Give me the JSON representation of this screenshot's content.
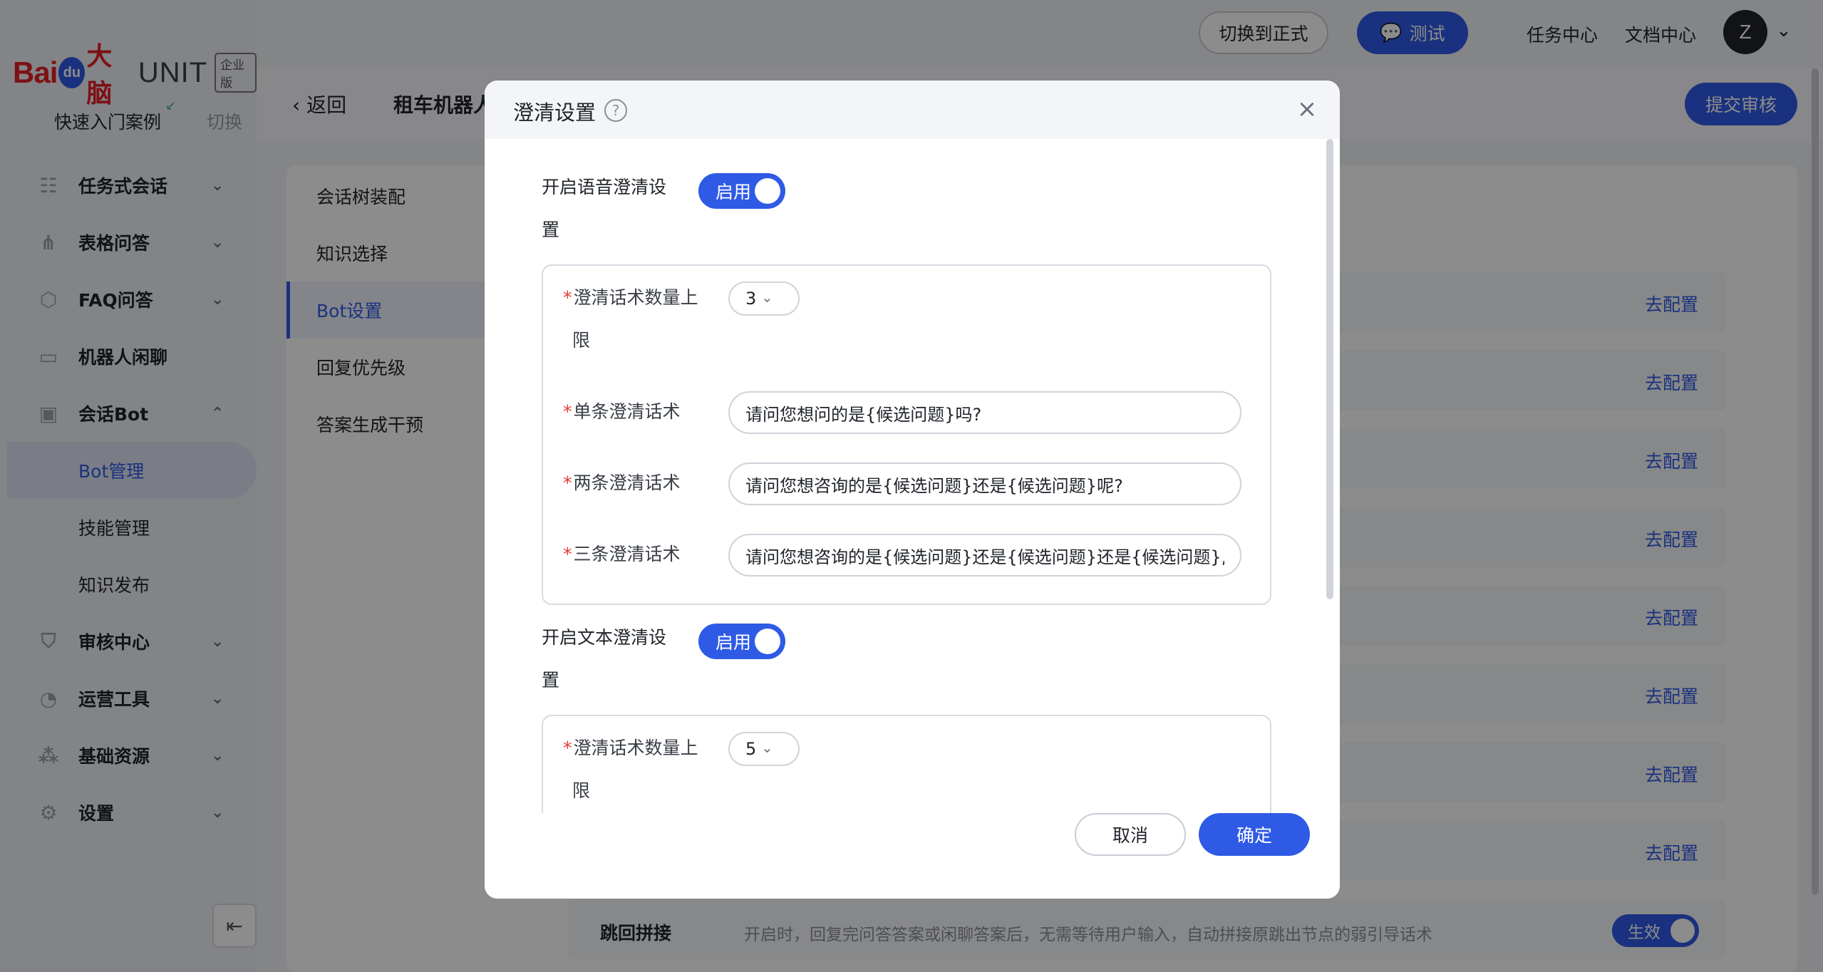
{
  "brand": {
    "bai": "Bai",
    "du": "du",
    "danao": "大脑",
    "unit": "UNIT",
    "edition": "企业版"
  },
  "quick_start": {
    "label": "快速入门案例",
    "switch": "切换"
  },
  "sidebar": {
    "items": [
      {
        "label": "任务式会话",
        "icon": "task-dialog-icon",
        "chevron": "⌄"
      },
      {
        "label": "表格问答",
        "icon": "table-qa-icon",
        "chevron": "⌄"
      },
      {
        "label": "FAQ问答",
        "icon": "faq-icon",
        "chevron": "⌄"
      },
      {
        "label": "机器人闲聊",
        "icon": "chat-icon",
        "chevron": ""
      },
      {
        "label": "会话Bot",
        "icon": "bot-icon",
        "chevron": "⌃"
      },
      {
        "label": "审核中心",
        "icon": "shield-icon",
        "chevron": "⌄"
      },
      {
        "label": "运营工具",
        "icon": "tools-icon",
        "chevron": "⌄"
      },
      {
        "label": "基础资源",
        "icon": "resources-icon",
        "chevron": "⌄"
      },
      {
        "label": "设置",
        "icon": "settings-icon",
        "chevron": "⌄"
      }
    ],
    "sub_items": [
      {
        "label": "Bot管理",
        "active": true
      },
      {
        "label": "技能管理",
        "active": false
      },
      {
        "label": "知识发布",
        "active": false
      }
    ]
  },
  "topbar": {
    "switch_formal": "切换到正式",
    "test": "测试",
    "task_center": "任务中心",
    "doc_center": "文档中心",
    "avatar_initial": "Z"
  },
  "subheader": {
    "back": "返回",
    "bot_name": "租车机器人",
    "submit": "提交审核"
  },
  "content_menu": [
    {
      "label": "会话树装配",
      "active": false
    },
    {
      "label": "知识选择",
      "active": false
    },
    {
      "label": "Bot设置",
      "active": true
    },
    {
      "label": "回复优先级",
      "active": false
    },
    {
      "label": "答案生成干预",
      "active": false
    }
  ],
  "config_link": "去配置",
  "bottom_row": {
    "title": "跳回拼接",
    "desc": "开启时，回复完问答答案或闲聊答案后，无需等待用户输入，自动拼接原跳出节点的弱引导话术",
    "toggle": "生效"
  },
  "modal": {
    "title": "澄清设置",
    "voice": {
      "label_line1": "开启语音澄清设",
      "label_line2": "置",
      "toggle": "启用",
      "count_label_line1": "澄清话术数量上",
      "count_label_line2": "限",
      "count_value": "3",
      "single_label": "单条澄清话术",
      "single_value": "请问您想问的是{候选问题}吗?",
      "double_label": "两条澄清话术",
      "double_value": "请问您想咨询的是{候选问题}还是{候选问题}呢?",
      "triple_label": "三条澄清话术",
      "triple_value": "请问您想咨询的是{候选问题}还是{候选问题}还是{候选问题},请"
    },
    "text": {
      "label_line1": "开启文本澄清设",
      "label_line2": "置",
      "toggle": "启用",
      "count_label_line1": "澄清话术数量上",
      "count_label_line2": "限",
      "count_value": "5"
    },
    "cancel": "取消",
    "ok": "确定"
  },
  "colors": {
    "primary": "#2e5ae6",
    "required": "#e53935",
    "brand_red": "#e31f27"
  }
}
